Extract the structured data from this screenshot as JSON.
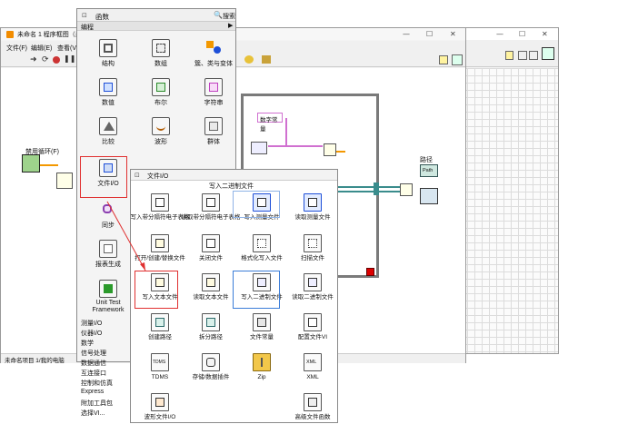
{
  "block_diagram": {
    "title": "未命名 1 程序框图（未",
    "menu": [
      "文件(F)",
      "编辑(E)",
      "查看(V"
    ],
    "status": "未命名项目 1/我的电脑",
    "node_label": "禁用循环(F)",
    "const_label": "数字常量",
    "path_label": "路径",
    "path_icon_text": "Path"
  },
  "window_controls": {
    "min": "—",
    "max": "☐",
    "close": "✕"
  },
  "functions_palette": {
    "title": "函数",
    "search": "搜索",
    "subtitle": "编程",
    "items": [
      {
        "label": "结构",
        "icon": "structures-icon"
      },
      {
        "label": "数组",
        "icon": "array-icon"
      },
      {
        "label": "簇、类与变体",
        "icon": "cluster-icon"
      },
      {
        "label": "数值",
        "icon": "numeric-icon"
      },
      {
        "label": "布尔",
        "icon": "boolean-icon"
      },
      {
        "label": "字符串",
        "icon": "string-icon"
      },
      {
        "label": "比较",
        "icon": "comparison-icon"
      },
      {
        "label": "波形",
        "icon": "waveform-icon"
      },
      {
        "label": "群体",
        "icon": "group-icon"
      },
      {
        "label": "文件I/O",
        "icon": "file-io-icon"
      },
      {
        "label": "同步",
        "icon": "sync-icon"
      },
      {
        "label": "报表生成",
        "icon": "report-icon"
      },
      {
        "label": "Unit Test Framework",
        "icon": "unit-test-icon"
      }
    ],
    "categories": [
      "测量I/O",
      "仪器I/O",
      "数学",
      "信号处理",
      "数据通信",
      "互连接口",
      "控制和仿真",
      "Express",
      "附加工具包",
      "选择VI..."
    ]
  },
  "file_io_palette": {
    "title": "文件I/O",
    "tooltip": "写入二进制文件",
    "items": [
      "写入带分隔符电子表格",
      "读取带分隔符电子表格",
      "写入测量文件",
      "读取测量文件",
      "打开/创建/替换文件",
      "关闭文件",
      "格式化写入文件",
      "扫描文件",
      "写入文本文件",
      "读取文本文件",
      "写入二进制文件",
      "读取二进制文件",
      "创建路径",
      "拆分路径",
      "文件常量",
      "配置文件VI",
      "TDMS",
      "存储/数据插件",
      "Zip",
      "XML",
      "波形文件I/O",
      "高级文件函数"
    ],
    "icon_texts": {
      "tdms": "TDMS",
      "xml": "XML"
    }
  }
}
